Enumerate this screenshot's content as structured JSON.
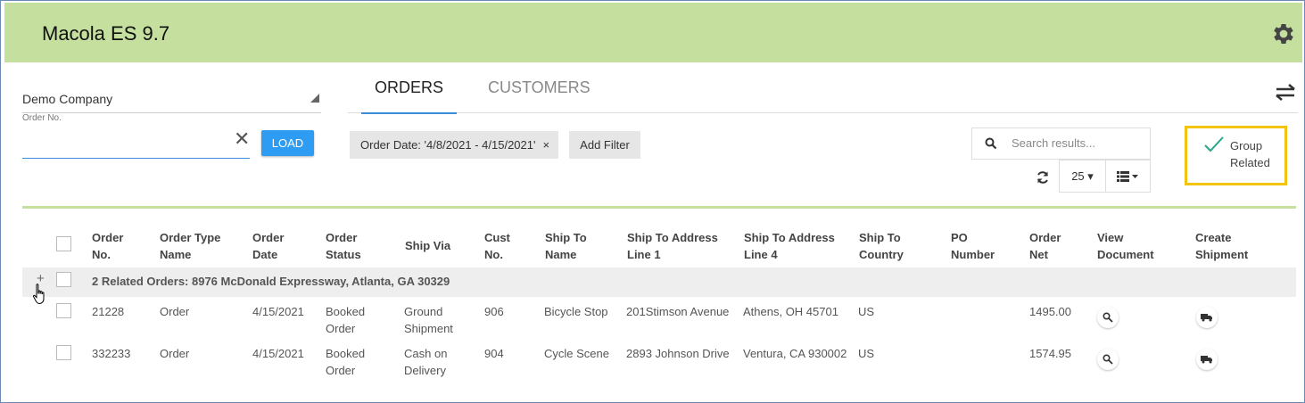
{
  "app": {
    "title": "Macola ES 9.7"
  },
  "left_panel": {
    "company": "Demo Company",
    "order_label": "Order No.",
    "order_value": "",
    "load_label": "LOAD"
  },
  "tabs": [
    {
      "label": "ORDERS",
      "active": true
    },
    {
      "label": "CUSTOMERS",
      "active": false
    }
  ],
  "filters": {
    "chip_label": "Order Date: '4/8/2021 - 4/15/2021'",
    "chip_remove": "×",
    "add_filter_label": "Add Filter"
  },
  "search": {
    "placeholder": "Search results..."
  },
  "toolbar": {
    "page_size": "25"
  },
  "group_related": {
    "line1": "Group",
    "line2": "Related",
    "checked": true
  },
  "table": {
    "columns": [
      {
        "line1": "Order",
        "line2": "No."
      },
      {
        "line1": "Order Type",
        "line2": "Name"
      },
      {
        "line1": "Order",
        "line2": "Date"
      },
      {
        "line1": "Order",
        "line2": "Status"
      },
      {
        "line1": "Ship Via",
        "line2": ""
      },
      {
        "line1": "Cust",
        "line2": "No."
      },
      {
        "line1": "Ship To",
        "line2": "Name"
      },
      {
        "line1": "Ship To Address",
        "line2": "Line 1"
      },
      {
        "line1": "Ship To Address",
        "line2": "Line 4"
      },
      {
        "line1": "Ship To",
        "line2": "Country"
      },
      {
        "line1": "PO",
        "line2": "Number"
      },
      {
        "line1": "Order",
        "line2": "Net"
      },
      {
        "line1": "View",
        "line2": "Document"
      },
      {
        "line1": "Create",
        "line2": "Shipment"
      }
    ],
    "group": {
      "expand": "+",
      "label": "2 Related Orders: 8976 McDonald Expressway, Atlanta, GA 30329"
    },
    "rows": [
      {
        "order_no": "21228",
        "type": "Order",
        "date": "4/15/2021",
        "status1": "Booked",
        "status2": "Order",
        "via1": "Ground",
        "via2": "Shipment",
        "cust": "906",
        "ship_name": "Bicycle Stop",
        "addr1": "201Stimson Avenue",
        "addr4": "Athens, OH 45701",
        "country": "US",
        "po": "",
        "net": "1495.00"
      },
      {
        "order_no": "332233",
        "type": "Order",
        "date": "4/15/2021",
        "status1": "Booked",
        "status2": "Order",
        "via1": "Cash on",
        "via2": "Delivery",
        "cust": "904",
        "ship_name": "Cycle Scene",
        "addr1": "2893 Johnson Drive",
        "addr4": "Ventura, CA 930002",
        "country": "US",
        "po": "",
        "net": "1574.95"
      }
    ]
  },
  "colors": {
    "header": "#c5df9f",
    "accent": "#2e9cf2",
    "highlight": "#f2c40f",
    "check": "#2aa58a"
  }
}
